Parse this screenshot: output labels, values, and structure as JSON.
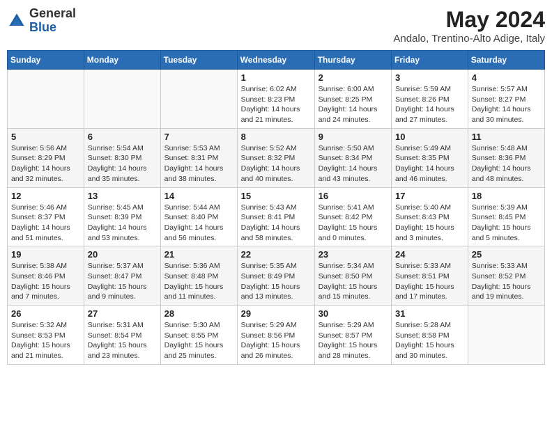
{
  "header": {
    "logo_general": "General",
    "logo_blue": "Blue",
    "month_title": "May 2024",
    "subtitle": "Andalo, Trentino-Alto Adige, Italy"
  },
  "weekdays": [
    "Sunday",
    "Monday",
    "Tuesday",
    "Wednesday",
    "Thursday",
    "Friday",
    "Saturday"
  ],
  "weeks": [
    [
      {
        "day": "",
        "detail": ""
      },
      {
        "day": "",
        "detail": ""
      },
      {
        "day": "",
        "detail": ""
      },
      {
        "day": "1",
        "detail": "Sunrise: 6:02 AM\nSunset: 8:23 PM\nDaylight: 14 hours\nand 21 minutes."
      },
      {
        "day": "2",
        "detail": "Sunrise: 6:00 AM\nSunset: 8:25 PM\nDaylight: 14 hours\nand 24 minutes."
      },
      {
        "day": "3",
        "detail": "Sunrise: 5:59 AM\nSunset: 8:26 PM\nDaylight: 14 hours\nand 27 minutes."
      },
      {
        "day": "4",
        "detail": "Sunrise: 5:57 AM\nSunset: 8:27 PM\nDaylight: 14 hours\nand 30 minutes."
      }
    ],
    [
      {
        "day": "5",
        "detail": "Sunrise: 5:56 AM\nSunset: 8:29 PM\nDaylight: 14 hours\nand 32 minutes."
      },
      {
        "day": "6",
        "detail": "Sunrise: 5:54 AM\nSunset: 8:30 PM\nDaylight: 14 hours\nand 35 minutes."
      },
      {
        "day": "7",
        "detail": "Sunrise: 5:53 AM\nSunset: 8:31 PM\nDaylight: 14 hours\nand 38 minutes."
      },
      {
        "day": "8",
        "detail": "Sunrise: 5:52 AM\nSunset: 8:32 PM\nDaylight: 14 hours\nand 40 minutes."
      },
      {
        "day": "9",
        "detail": "Sunrise: 5:50 AM\nSunset: 8:34 PM\nDaylight: 14 hours\nand 43 minutes."
      },
      {
        "day": "10",
        "detail": "Sunrise: 5:49 AM\nSunset: 8:35 PM\nDaylight: 14 hours\nand 46 minutes."
      },
      {
        "day": "11",
        "detail": "Sunrise: 5:48 AM\nSunset: 8:36 PM\nDaylight: 14 hours\nand 48 minutes."
      }
    ],
    [
      {
        "day": "12",
        "detail": "Sunrise: 5:46 AM\nSunset: 8:37 PM\nDaylight: 14 hours\nand 51 minutes."
      },
      {
        "day": "13",
        "detail": "Sunrise: 5:45 AM\nSunset: 8:39 PM\nDaylight: 14 hours\nand 53 minutes."
      },
      {
        "day": "14",
        "detail": "Sunrise: 5:44 AM\nSunset: 8:40 PM\nDaylight: 14 hours\nand 56 minutes."
      },
      {
        "day": "15",
        "detail": "Sunrise: 5:43 AM\nSunset: 8:41 PM\nDaylight: 14 hours\nand 58 minutes."
      },
      {
        "day": "16",
        "detail": "Sunrise: 5:41 AM\nSunset: 8:42 PM\nDaylight: 15 hours\nand 0 minutes."
      },
      {
        "day": "17",
        "detail": "Sunrise: 5:40 AM\nSunset: 8:43 PM\nDaylight: 15 hours\nand 3 minutes."
      },
      {
        "day": "18",
        "detail": "Sunrise: 5:39 AM\nSunset: 8:45 PM\nDaylight: 15 hours\nand 5 minutes."
      }
    ],
    [
      {
        "day": "19",
        "detail": "Sunrise: 5:38 AM\nSunset: 8:46 PM\nDaylight: 15 hours\nand 7 minutes."
      },
      {
        "day": "20",
        "detail": "Sunrise: 5:37 AM\nSunset: 8:47 PM\nDaylight: 15 hours\nand 9 minutes."
      },
      {
        "day": "21",
        "detail": "Sunrise: 5:36 AM\nSunset: 8:48 PM\nDaylight: 15 hours\nand 11 minutes."
      },
      {
        "day": "22",
        "detail": "Sunrise: 5:35 AM\nSunset: 8:49 PM\nDaylight: 15 hours\nand 13 minutes."
      },
      {
        "day": "23",
        "detail": "Sunrise: 5:34 AM\nSunset: 8:50 PM\nDaylight: 15 hours\nand 15 minutes."
      },
      {
        "day": "24",
        "detail": "Sunrise: 5:33 AM\nSunset: 8:51 PM\nDaylight: 15 hours\nand 17 minutes."
      },
      {
        "day": "25",
        "detail": "Sunrise: 5:33 AM\nSunset: 8:52 PM\nDaylight: 15 hours\nand 19 minutes."
      }
    ],
    [
      {
        "day": "26",
        "detail": "Sunrise: 5:32 AM\nSunset: 8:53 PM\nDaylight: 15 hours\nand 21 minutes."
      },
      {
        "day": "27",
        "detail": "Sunrise: 5:31 AM\nSunset: 8:54 PM\nDaylight: 15 hours\nand 23 minutes."
      },
      {
        "day": "28",
        "detail": "Sunrise: 5:30 AM\nSunset: 8:55 PM\nDaylight: 15 hours\nand 25 minutes."
      },
      {
        "day": "29",
        "detail": "Sunrise: 5:29 AM\nSunset: 8:56 PM\nDaylight: 15 hours\nand 26 minutes."
      },
      {
        "day": "30",
        "detail": "Sunrise: 5:29 AM\nSunset: 8:57 PM\nDaylight: 15 hours\nand 28 minutes."
      },
      {
        "day": "31",
        "detail": "Sunrise: 5:28 AM\nSunset: 8:58 PM\nDaylight: 15 hours\nand 30 minutes."
      },
      {
        "day": "",
        "detail": ""
      }
    ]
  ]
}
